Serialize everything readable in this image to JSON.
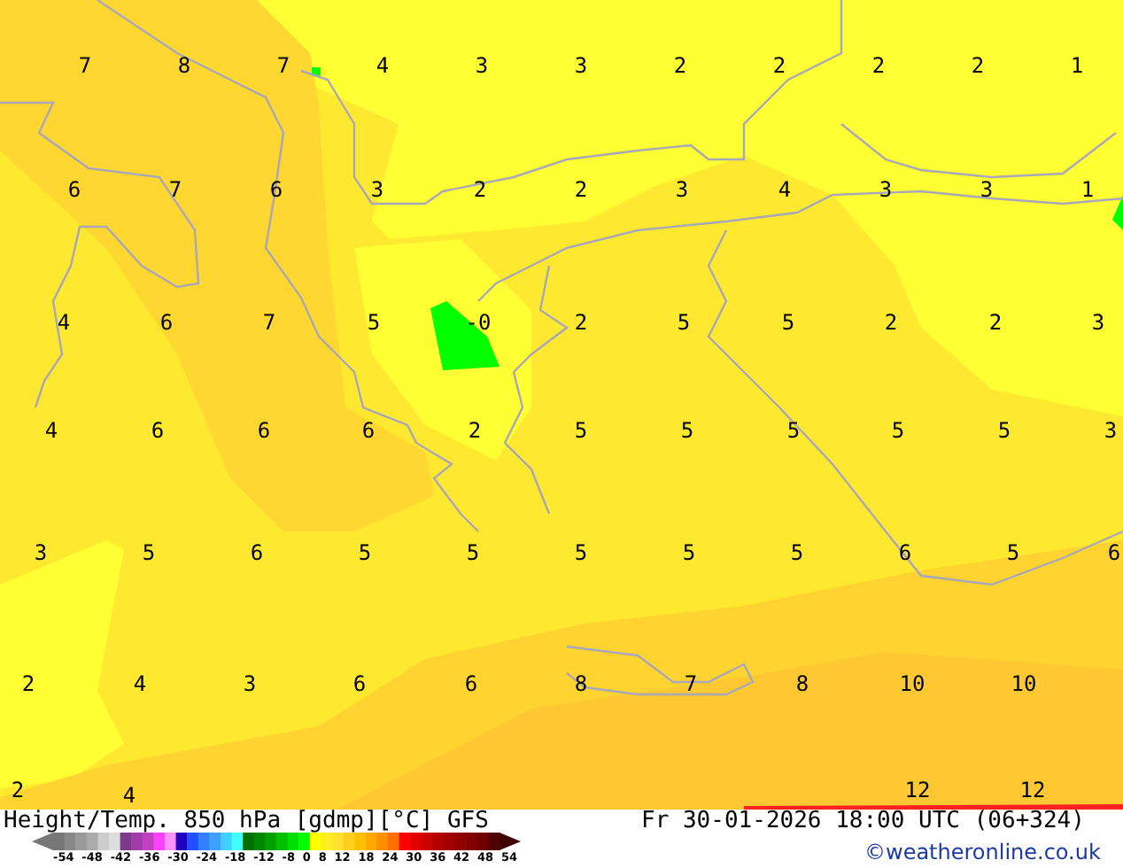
{
  "map": {
    "labels": [
      "7",
      "8",
      "7",
      "4",
      "3",
      "3",
      "2",
      "2",
      "2",
      "2",
      "1",
      "6",
      "7",
      "6",
      "3",
      "2",
      "2",
      "3",
      "4",
      "3",
      "3",
      "1",
      "4",
      "6",
      "7",
      "5",
      "-0",
      "2",
      "5",
      "5",
      "2",
      "2",
      "3",
      "4",
      "6",
      "6",
      "6",
      "2",
      "5",
      "5",
      "5",
      "5",
      "5",
      "3",
      "3",
      "5",
      "6",
      "5",
      "5",
      "5",
      "5",
      "5",
      "6",
      "5",
      "6",
      "2",
      "4",
      "3",
      "6",
      "6",
      "8",
      "7",
      "8",
      "10",
      "10",
      "2",
      "4",
      "12",
      "12"
    ]
  },
  "legend": {
    "title": "Height/Temp. 850 hPa [gdmp][°C] GFS",
    "ticks": [
      "-54",
      "-48",
      "-42",
      "-36",
      "-30",
      "-24",
      "-18",
      "-12",
      "-8",
      "0",
      "8",
      "12",
      "18",
      "24",
      "30",
      "36",
      "42",
      "48",
      "54"
    ]
  },
  "valid_time": "Fr 30-01-2026 18:00 UTC (06+324)",
  "credit": "©weatheronline.co.uk"
}
